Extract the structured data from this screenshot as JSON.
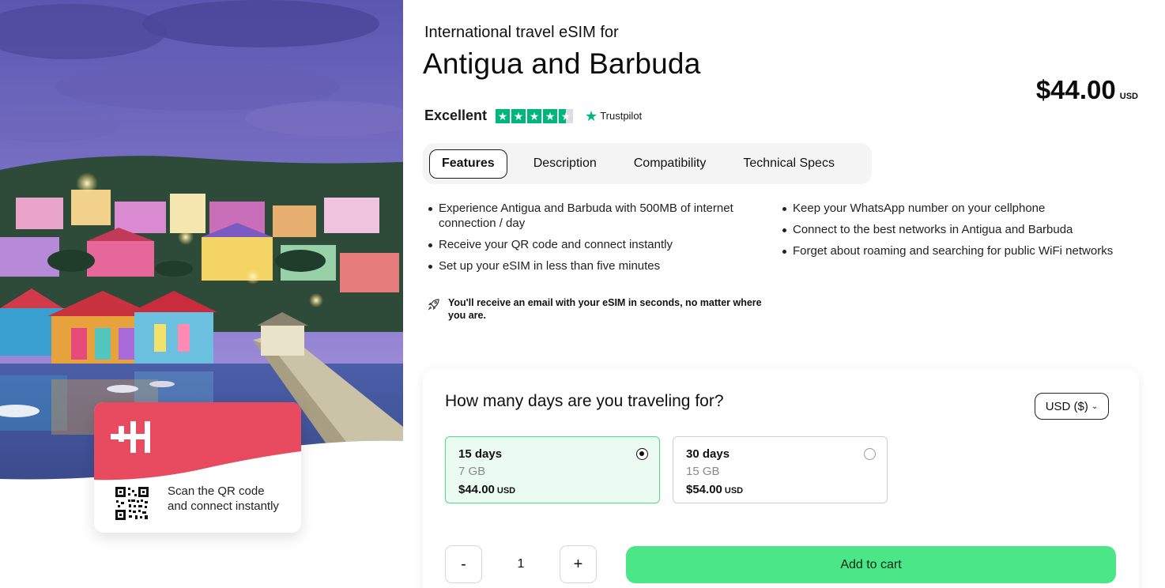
{
  "hero": {
    "scan_text": "Scan the QR code and connect instantly"
  },
  "product": {
    "subtitle": "International travel eSIM for",
    "title": "Antigua and Barbuda",
    "price_amount": "$44.00",
    "price_currency": "USD"
  },
  "rating": {
    "label": "Excellent",
    "stars": 4.5,
    "provider": "Trustpilot"
  },
  "tabs": [
    {
      "label": "Features",
      "active": true
    },
    {
      "label": "Description",
      "active": false
    },
    {
      "label": "Compatibility",
      "active": false
    },
    {
      "label": "Technical Specs",
      "active": false
    }
  ],
  "features": {
    "left": [
      "Experience Antigua and Barbuda with 500MB of internet connection / day",
      "Receive your QR code and connect instantly",
      "Set up your eSIM in less than five minutes"
    ],
    "right": [
      "Keep your WhatsApp number on your cellphone",
      "Connect to the best networks in Antigua and Barbuda",
      "Forget about roaming and searching for public WiFi networks"
    ],
    "email_note": "You'll receive an email with your eSIM in seconds, no matter where you are."
  },
  "purchase": {
    "question": "How many days are you traveling for?",
    "currency_selector": "USD ($)",
    "plans": [
      {
        "days": "15 days",
        "data": "7 GB",
        "price": "$44.00",
        "currency": "USD",
        "selected": true
      },
      {
        "days": "30 days",
        "data": "15 GB",
        "price": "$54.00",
        "currency": "USD",
        "selected": false
      }
    ],
    "quantity": "1",
    "minus_label": "-",
    "plus_label": "+",
    "add_to_cart": "Add to cart"
  },
  "colors": {
    "accent_green": "#4ae687",
    "brand_red": "#e84a5f",
    "trustpilot_green": "#00b67a"
  }
}
